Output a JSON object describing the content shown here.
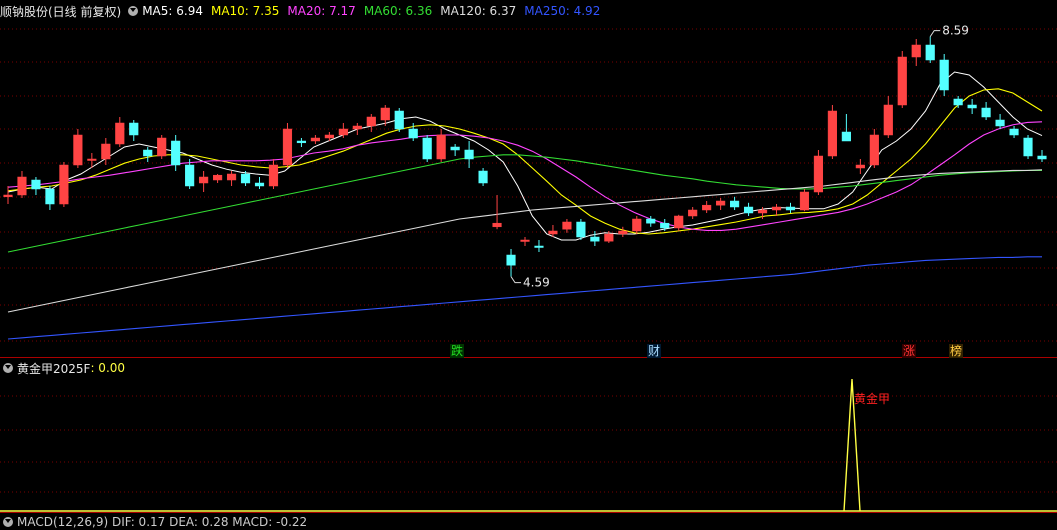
{
  "header": {
    "title": "顺钠股份(日线 前复权)",
    "ma": [
      {
        "label": "MA5: 6.94",
        "color": "#ffffff"
      },
      {
        "label": "MA10: 7.35",
        "color": "#ffff00"
      },
      {
        "label": "MA20: 7.17",
        "color": "#ff44ff"
      },
      {
        "label": "MA60: 6.36",
        "color": "#33dd33"
      },
      {
        "label": "MA120: 6.37",
        "color": "#dddddd"
      },
      {
        "label": "MA250: 4.92",
        "color": "#3355ff"
      }
    ]
  },
  "indicator": {
    "title": "黄金甲2025F",
    "value": ": 0.00",
    "signal_label": "黄金甲"
  },
  "bottom_panel_title": "MACD(12,26,9)  DIF: 0.17  DEA: 0.28  MACD: -0.22",
  "markers": [
    {
      "text": "跌",
      "color": "#22dd22",
      "bg": "#003300",
      "index": 27
    },
    {
      "text": "财",
      "color": "#aaddff",
      "bg": "#001a33",
      "index": 39
    },
    {
      "text": "涨",
      "color": "#ff3333",
      "bg": "#330000",
      "index": 54
    },
    {
      "text": "榜",
      "color": "#ffcc44",
      "bg": "#332200",
      "index": 57
    }
  ],
  "colors": {
    "up": "#ff4444",
    "down": "#54ffff",
    "grid": "#7a0000",
    "separator": "#aa0000",
    "signal": "#ffff44",
    "signal_text": "#ff2020"
  },
  "chart_data": {
    "type": "candlestick",
    "x": [
      "1",
      "2",
      "3",
      "4",
      "5",
      "6",
      "7",
      "8",
      "9",
      "10",
      "11",
      "12",
      "13",
      "14",
      "15",
      "16",
      "16b",
      "17",
      "18",
      "19",
      "20",
      "21",
      "22",
      "23",
      "24",
      "25",
      "26",
      "27",
      "28",
      "29",
      "30",
      "31",
      "32",
      "33",
      "34",
      "35",
      "36",
      "37",
      "38",
      "39",
      "40",
      "41",
      "42",
      "43",
      "44",
      "45",
      "46",
      "47",
      "48",
      "49",
      "50",
      "51",
      "52",
      "53",
      "54",
      "55",
      "56",
      "57",
      "58",
      "59",
      "60",
      "61",
      "62"
    ],
    "ohlc": [
      [
        5.92,
        6.1,
        5.8,
        5.95
      ],
      [
        5.95,
        6.35,
        5.9,
        6.25
      ],
      [
        6.2,
        6.25,
        5.95,
        6.05
      ],
      [
        6.05,
        6.1,
        5.7,
        5.8
      ],
      [
        5.8,
        6.5,
        5.75,
        6.45
      ],
      [
        6.45,
        7.05,
        6.4,
        6.95
      ],
      [
        6.55,
        6.65,
        6.4,
        6.55
      ],
      [
        6.55,
        6.9,
        6.45,
        6.8
      ],
      [
        6.8,
        7.25,
        6.75,
        7.15
      ],
      [
        7.15,
        7.2,
        6.85,
        6.95
      ],
      [
        6.7,
        6.75,
        6.5,
        6.6
      ],
      [
        6.6,
        6.95,
        6.55,
        6.9
      ],
      [
        6.85,
        6.95,
        6.35,
        6.45
      ],
      [
        6.45,
        6.55,
        6.05,
        6.1
      ],
      [
        6.15,
        6.35,
        6.0,
        6.25
      ],
      [
        6.2,
        6.3,
        6.15,
        6.28
      ],
      [
        6.2,
        6.35,
        6.1,
        6.3
      ],
      [
        6.3,
        6.35,
        6.1,
        6.15
      ],
      [
        6.15,
        6.25,
        6.05,
        6.1
      ],
      [
        6.1,
        6.55,
        6.05,
        6.45
      ],
      [
        6.45,
        7.15,
        6.4,
        7.05
      ],
      [
        6.85,
        6.9,
        6.75,
        6.82
      ],
      [
        6.85,
        6.95,
        6.8,
        6.9
      ],
      [
        6.9,
        7.0,
        6.85,
        6.95
      ],
      [
        6.95,
        7.15,
        6.9,
        7.05
      ],
      [
        7.05,
        7.15,
        6.95,
        7.1
      ],
      [
        7.1,
        7.3,
        7.0,
        7.25
      ],
      [
        7.2,
        7.45,
        7.1,
        7.4
      ],
      [
        7.35,
        7.4,
        7.0,
        7.05
      ],
      [
        7.05,
        7.15,
        6.85,
        6.9
      ],
      [
        6.9,
        6.95,
        6.5,
        6.55
      ],
      [
        6.55,
        7.05,
        6.5,
        6.95
      ],
      [
        6.75,
        6.8,
        6.6,
        6.7
      ],
      [
        6.7,
        6.85,
        6.4,
        6.55
      ],
      [
        6.35,
        6.4,
        6.1,
        6.15
      ],
      [
        5.42,
        5.95,
        5.38,
        5.48
      ],
      [
        4.95,
        5.05,
        4.59,
        4.78
      ],
      [
        5.18,
        5.25,
        5.1,
        5.2
      ],
      [
        5.1,
        5.2,
        5.0,
        5.08
      ],
      [
        5.3,
        5.45,
        5.25,
        5.35
      ]
    ],
    "ohlc_tail": [
      [
        5.38,
        5.55,
        5.32,
        5.5
      ],
      [
        5.5,
        5.55,
        5.2,
        5.25
      ],
      [
        5.25,
        5.35,
        5.1,
        5.18
      ],
      [
        5.18,
        5.35,
        5.15,
        5.3
      ],
      [
        5.3,
        5.42,
        5.25,
        5.35
      ],
      [
        5.35,
        5.6,
        5.3,
        5.55
      ],
      [
        5.55,
        5.6,
        5.42,
        5.48
      ],
      [
        5.48,
        5.55,
        5.35,
        5.4
      ],
      [
        5.4,
        5.62,
        5.35,
        5.6
      ],
      [
        5.6,
        5.75,
        5.55,
        5.7
      ],
      [
        5.7,
        5.85,
        5.65,
        5.78
      ],
      [
        5.78,
        5.9,
        5.7,
        5.85
      ],
      [
        5.85,
        5.92,
        5.7,
        5.75
      ],
      [
        5.75,
        5.82,
        5.6,
        5.65
      ],
      [
        5.65,
        5.75,
        5.55,
        5.7
      ],
      [
        5.7,
        5.8,
        5.6,
        5.75
      ],
      [
        5.75,
        5.82,
        5.65,
        5.7
      ],
      [
        5.7,
        6.05,
        5.68,
        6.0
      ],
      [
        6.0,
        6.7,
        5.95,
        6.6
      ],
      [
        6.6,
        7.45,
        6.55,
        7.35
      ],
      [
        7.0,
        7.3,
        6.85,
        6.85
      ],
      [
        6.4,
        6.55,
        6.3,
        6.45
      ],
      [
        6.45,
        7.05,
        6.4,
        6.95
      ],
      [
        6.95,
        7.6,
        6.9,
        7.45
      ],
      [
        7.45,
        8.35,
        7.4,
        8.25
      ],
      [
        8.25,
        8.55,
        8.1,
        8.45
      ],
      [
        8.45,
        8.59,
        8.15,
        8.2
      ],
      [
        8.2,
        8.3,
        7.6,
        7.7
      ],
      [
        7.55,
        7.6,
        7.4,
        7.45
      ],
      [
        7.45,
        7.55,
        7.3,
        7.4
      ],
      [
        7.4,
        7.5,
        7.2,
        7.25
      ],
      [
        7.2,
        7.3,
        7.05,
        7.1
      ],
      [
        7.05,
        7.1,
        6.9,
        6.95
      ],
      [
        6.9,
        6.95,
        6.55,
        6.6
      ],
      [
        6.6,
        6.7,
        6.5,
        6.55
      ]
    ],
    "ma": {
      "MA5": [
        6.0,
        6.05,
        6.08,
        6.05,
        6.2,
        6.3,
        6.45,
        6.6,
        6.75,
        6.8,
        6.75,
        6.7,
        6.65,
        6.55,
        6.45,
        6.38,
        6.33,
        6.3,
        6.28,
        6.35,
        6.55,
        6.75,
        6.85,
        6.95,
        7.05,
        7.1,
        7.15,
        7.22,
        7.25,
        7.18,
        7.05,
        6.95,
        6.85,
        6.7,
        6.5,
        6.1,
        5.6,
        5.3,
        5.2,
        5.2,
        5.28,
        5.32,
        5.3,
        5.3,
        5.33,
        5.38,
        5.42,
        5.45,
        5.5,
        5.55,
        5.62,
        5.68,
        5.72,
        5.74,
        5.73,
        5.72,
        5.72,
        5.8,
        6.0,
        6.35,
        6.7,
        6.85,
        7.05,
        7.35,
        7.8,
        8.0,
        7.95,
        7.75,
        7.5,
        7.25,
        7.05,
        6.94
      ],
      "MA10": [
        6.02,
        6.05,
        6.08,
        6.1,
        6.15,
        6.2,
        6.28,
        6.38,
        6.48,
        6.55,
        6.6,
        6.62,
        6.62,
        6.6,
        6.55,
        6.5,
        6.45,
        6.42,
        6.4,
        6.42,
        6.45,
        6.52,
        6.6,
        6.68,
        6.78,
        6.88,
        6.98,
        7.05,
        7.1,
        7.12,
        7.1,
        7.05,
        6.98,
        6.9,
        6.8,
        6.62,
        6.4,
        6.18,
        5.95,
        5.78,
        5.6,
        5.48,
        5.38,
        5.32,
        5.3,
        5.32,
        5.35,
        5.38,
        5.42,
        5.46,
        5.5,
        5.55,
        5.6,
        5.62,
        5.65,
        5.66,
        5.68,
        5.72,
        5.8,
        5.95,
        6.15,
        6.35,
        6.55,
        6.8,
        7.1,
        7.4,
        7.6,
        7.7,
        7.72,
        7.65,
        7.5,
        7.35
      ],
      "MA20": [
        6.08,
        6.1,
        6.12,
        6.15,
        6.18,
        6.22,
        6.25,
        6.28,
        6.32,
        6.36,
        6.4,
        6.44,
        6.48,
        6.5,
        6.52,
        6.52,
        6.52,
        6.52,
        6.53,
        6.55,
        6.6,
        6.65,
        6.68,
        6.72,
        6.78,
        6.82,
        6.85,
        6.88,
        6.92,
        6.94,
        6.95,
        6.95,
        6.93,
        6.9,
        6.85,
        6.78,
        6.68,
        6.55,
        6.4,
        6.25,
        6.08,
        5.92,
        5.78,
        5.66,
        5.56,
        5.48,
        5.42,
        5.38,
        5.36,
        5.36,
        5.38,
        5.42,
        5.46,
        5.5,
        5.54,
        5.58,
        5.62,
        5.66,
        5.72,
        5.8,
        5.9,
        6.0,
        6.12,
        6.28,
        6.45,
        6.62,
        6.8,
        6.95,
        7.05,
        7.12,
        7.16,
        7.17
      ],
      "MA60": [
        5.0,
        5.05,
        5.1,
        5.15,
        5.2,
        5.25,
        5.3,
        5.35,
        5.4,
        5.45,
        5.5,
        5.55,
        5.6,
        5.65,
        5.7,
        5.75,
        5.8,
        5.85,
        5.9,
        5.95,
        6.0,
        6.05,
        6.1,
        6.15,
        6.2,
        6.25,
        6.3,
        6.35,
        6.4,
        6.45,
        6.5,
        6.55,
        6.58,
        6.6,
        6.62,
        6.62,
        6.6,
        6.58,
        6.55,
        6.52,
        6.48,
        6.44,
        6.4,
        6.36,
        6.32,
        6.28,
        6.25,
        6.22,
        6.18,
        6.15,
        6.12,
        6.1,
        6.08,
        6.06,
        6.05,
        6.05,
        6.06,
        6.08,
        6.1,
        6.13,
        6.16,
        6.19,
        6.22,
        6.25,
        6.28,
        6.3,
        6.32,
        6.33,
        6.34,
        6.35,
        6.36,
        6.36
      ],
      "MA120": [
        4.0,
        4.05,
        4.1,
        4.15,
        4.2,
        4.25,
        4.3,
        4.35,
        4.4,
        4.45,
        4.5,
        4.55,
        4.6,
        4.65,
        4.7,
        4.75,
        4.8,
        4.85,
        4.9,
        4.95,
        5.0,
        5.05,
        5.1,
        5.15,
        5.2,
        5.25,
        5.3,
        5.35,
        5.4,
        5.45,
        5.5,
        5.55,
        5.58,
        5.61,
        5.64,
        5.67,
        5.7,
        5.72,
        5.74,
        5.76,
        5.78,
        5.8,
        5.82,
        5.84,
        5.86,
        5.88,
        5.9,
        5.92,
        5.94,
        5.96,
        5.98,
        6.0,
        6.02,
        6.04,
        6.06,
        6.08,
        6.1,
        6.13,
        6.16,
        6.19,
        6.22,
        6.25,
        6.27,
        6.29,
        6.31,
        6.32,
        6.33,
        6.34,
        6.35,
        6.36,
        6.36,
        6.37
      ],
      "MA250": [
        3.55,
        3.57,
        3.59,
        3.61,
        3.63,
        3.65,
        3.67,
        3.69,
        3.71,
        3.73,
        3.75,
        3.77,
        3.79,
        3.81,
        3.83,
        3.85,
        3.87,
        3.89,
        3.91,
        3.93,
        3.95,
        3.97,
        3.99,
        4.01,
        4.03,
        4.05,
        4.07,
        4.09,
        4.11,
        4.13,
        4.15,
        4.17,
        4.19,
        4.21,
        4.23,
        4.25,
        4.27,
        4.29,
        4.31,
        4.33,
        4.35,
        4.37,
        4.39,
        4.41,
        4.43,
        4.45,
        4.47,
        4.49,
        4.51,
        4.53,
        4.55,
        4.57,
        4.59,
        4.61,
        4.63,
        4.66,
        4.69,
        4.72,
        4.75,
        4.78,
        4.8,
        4.82,
        4.84,
        4.86,
        4.87,
        4.88,
        4.89,
        4.9,
        4.91,
        4.91,
        4.92,
        4.92
      ]
    },
    "annotations": [
      {
        "text": "8.59",
        "value": 8.59
      },
      {
        "text": "4.59",
        "value": 4.59
      }
    ],
    "ylim": [
      3.5,
      8.9
    ],
    "indicator_series": {
      "name": "黄金甲2025F",
      "values_nonzero": [
        {
          "index": 54,
          "value": 1
        }
      ]
    }
  }
}
